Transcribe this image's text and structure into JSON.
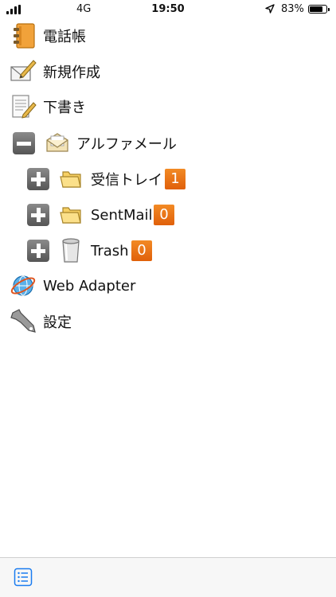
{
  "status_bar": {
    "network": "4G",
    "time": "19:50",
    "battery": "83%",
    "battery_level": 0.83
  },
  "tree": {
    "phonebook": "電話帳",
    "compose": "新規作成",
    "drafts": "下書き",
    "account": "アルファメール",
    "inbox": {
      "label": "受信トレイ",
      "count": "1"
    },
    "sent": {
      "label": "SentMail",
      "count": "0"
    },
    "trash": {
      "label": "Trash",
      "count": "0"
    },
    "web_adapter": "Web Adapter",
    "settings": "設定"
  },
  "colors": {
    "badge": "#e8700f",
    "toggle": "#6b6b6b",
    "toolbar_icon": "#1a7cf0"
  }
}
